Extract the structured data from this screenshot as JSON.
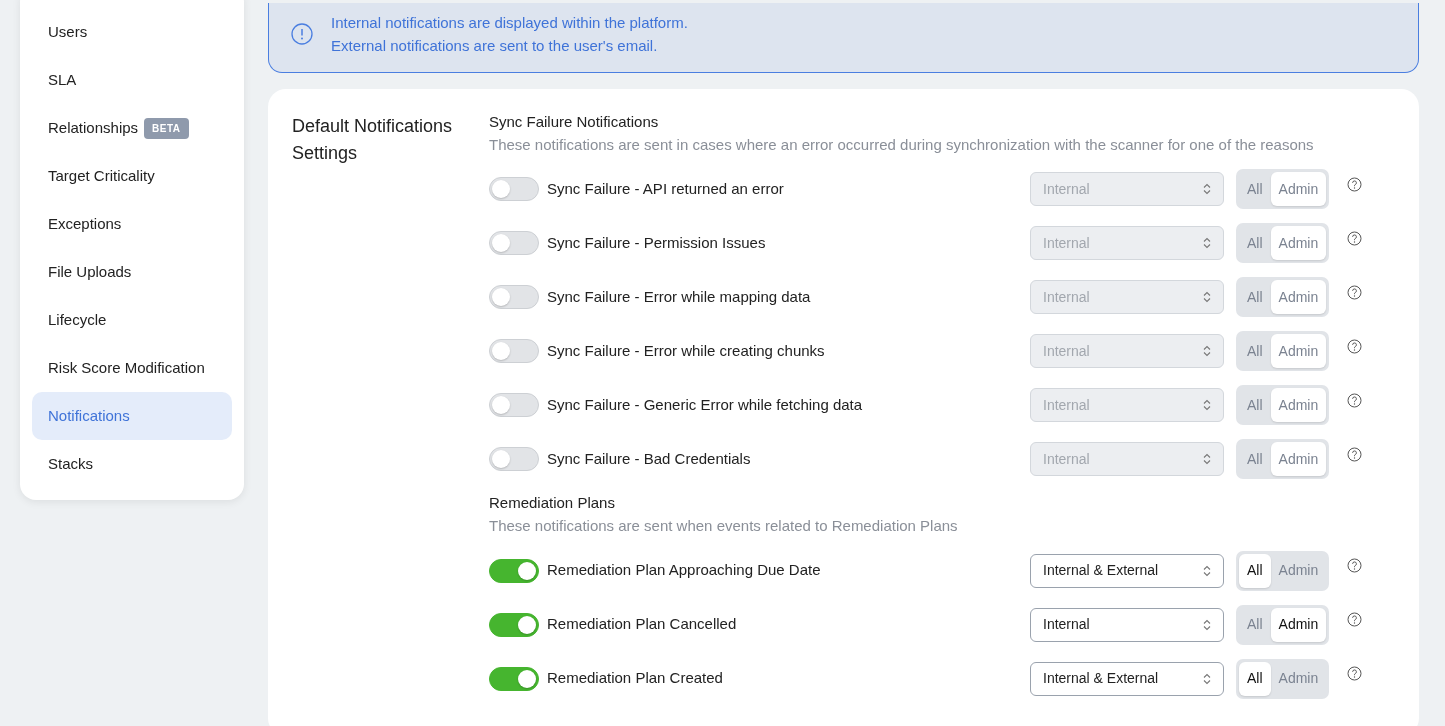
{
  "sidebar": {
    "items": [
      {
        "label": "Users",
        "selected": false
      },
      {
        "label": "SLA",
        "selected": false
      },
      {
        "label": "Relationships",
        "badge": "BETA",
        "selected": false
      },
      {
        "label": "Target Criticality",
        "selected": false
      },
      {
        "label": "Exceptions",
        "selected": false
      },
      {
        "label": "File Uploads",
        "selected": false
      },
      {
        "label": "Lifecycle",
        "selected": false
      },
      {
        "label": "Risk Score Modification",
        "selected": false
      },
      {
        "label": "Notifications",
        "selected": true
      },
      {
        "label": "Stacks",
        "selected": false
      }
    ]
  },
  "alert": {
    "lines": [
      "Internal notifications are displayed within the platform.",
      "External notifications are sent to the user's email."
    ]
  },
  "settings": {
    "title": "Default Notifications Settings",
    "sections": [
      {
        "title": "Sync Failure Notifications",
        "description": "These notifications are sent in cases where an error occurred during synchronization with the scanner for one of the reasons",
        "rows": [
          {
            "label": "Sync Failure - API returned an error",
            "on": false,
            "channel": "Internal",
            "disabled": true,
            "audience": [
              {
                "label": "All",
                "selected": false
              },
              {
                "label": "Admin",
                "selected": true
              }
            ]
          },
          {
            "label": "Sync Failure - Permission Issues",
            "on": false,
            "channel": "Internal",
            "disabled": true,
            "audience": [
              {
                "label": "All",
                "selected": false
              },
              {
                "label": "Admin",
                "selected": true
              }
            ]
          },
          {
            "label": "Sync Failure - Error while mapping data",
            "on": false,
            "channel": "Internal",
            "disabled": true,
            "audience": [
              {
                "label": "All",
                "selected": false
              },
              {
                "label": "Admin",
                "selected": true
              }
            ]
          },
          {
            "label": "Sync Failure - Error while creating chunks",
            "on": false,
            "channel": "Internal",
            "disabled": true,
            "audience": [
              {
                "label": "All",
                "selected": false
              },
              {
                "label": "Admin",
                "selected": true
              }
            ]
          },
          {
            "label": "Sync Failure - Generic Error while fetching data",
            "on": false,
            "channel": "Internal",
            "disabled": true,
            "audience": [
              {
                "label": "All",
                "selected": false
              },
              {
                "label": "Admin",
                "selected": true
              }
            ]
          },
          {
            "label": "Sync Failure - Bad Credentials",
            "on": false,
            "channel": "Internal",
            "disabled": true,
            "audience": [
              {
                "label": "All",
                "selected": false
              },
              {
                "label": "Admin",
                "selected": true
              }
            ]
          }
        ]
      },
      {
        "title": "Remediation Plans",
        "description": "These notifications are sent when events related to Remediation Plans",
        "rows": [
          {
            "label": "Remediation Plan Approaching Due Date",
            "on": true,
            "channel": "Internal & External",
            "disabled": false,
            "audience": [
              {
                "label": "All",
                "selected": true
              },
              {
                "label": "Admin",
                "selected": false
              }
            ]
          },
          {
            "label": "Remediation Plan Cancelled",
            "on": true,
            "channel": "Internal",
            "disabled": false,
            "audience": [
              {
                "label": "All",
                "selected": false
              },
              {
                "label": "Admin",
                "selected": true
              }
            ]
          },
          {
            "label": "Remediation Plan Created",
            "on": true,
            "channel": "Internal & External",
            "disabled": false,
            "audience": [
              {
                "label": "All",
                "selected": true
              },
              {
                "label": "Admin",
                "selected": false
              }
            ]
          }
        ]
      }
    ]
  }
}
